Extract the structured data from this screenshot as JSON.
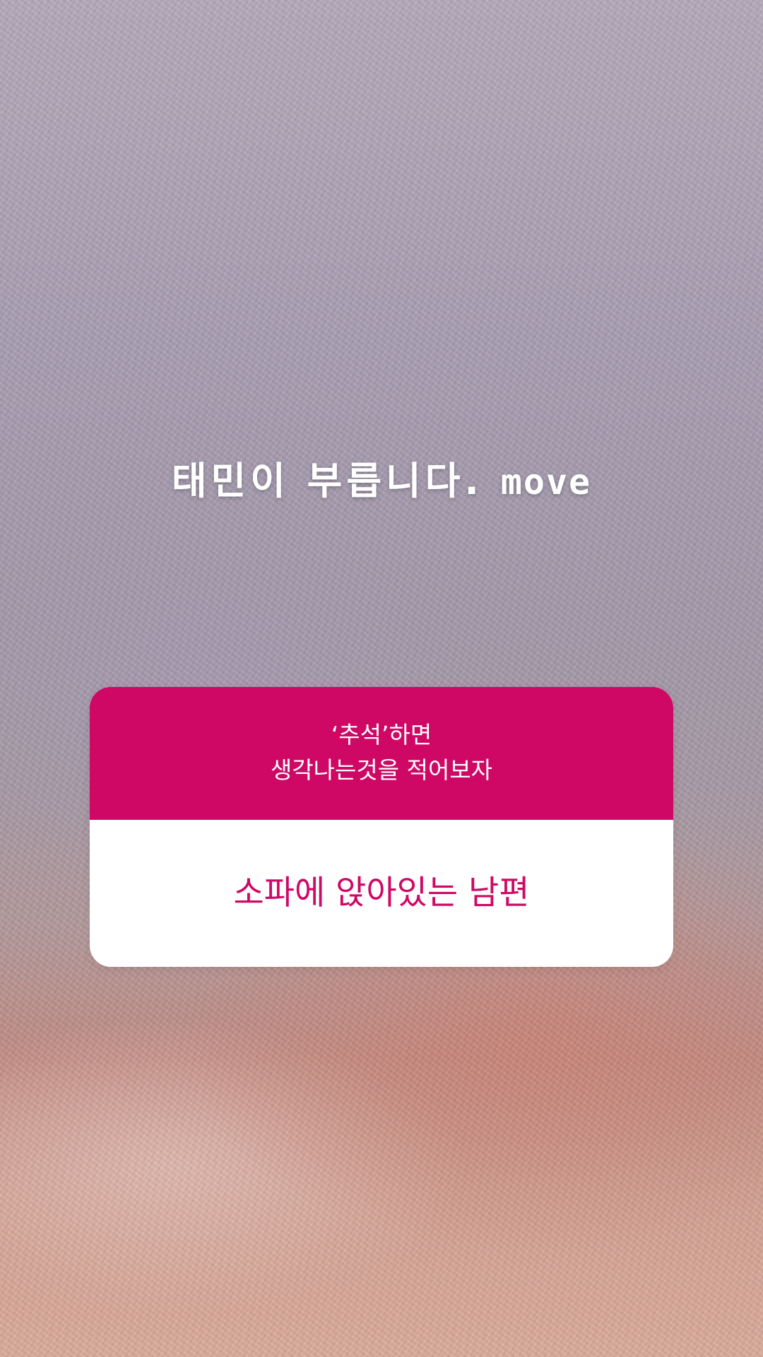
{
  "story": {
    "caption_text": "태민이 부릅니다.",
    "caption_song": "move"
  },
  "question_sticker": {
    "question_line1": "‘추석’하면",
    "question_line2": "생각나는것을 적어보자",
    "answer": "소파에 앉아있는 남편",
    "accent_color": "#cf0866",
    "answer_background": "#ffffff"
  }
}
